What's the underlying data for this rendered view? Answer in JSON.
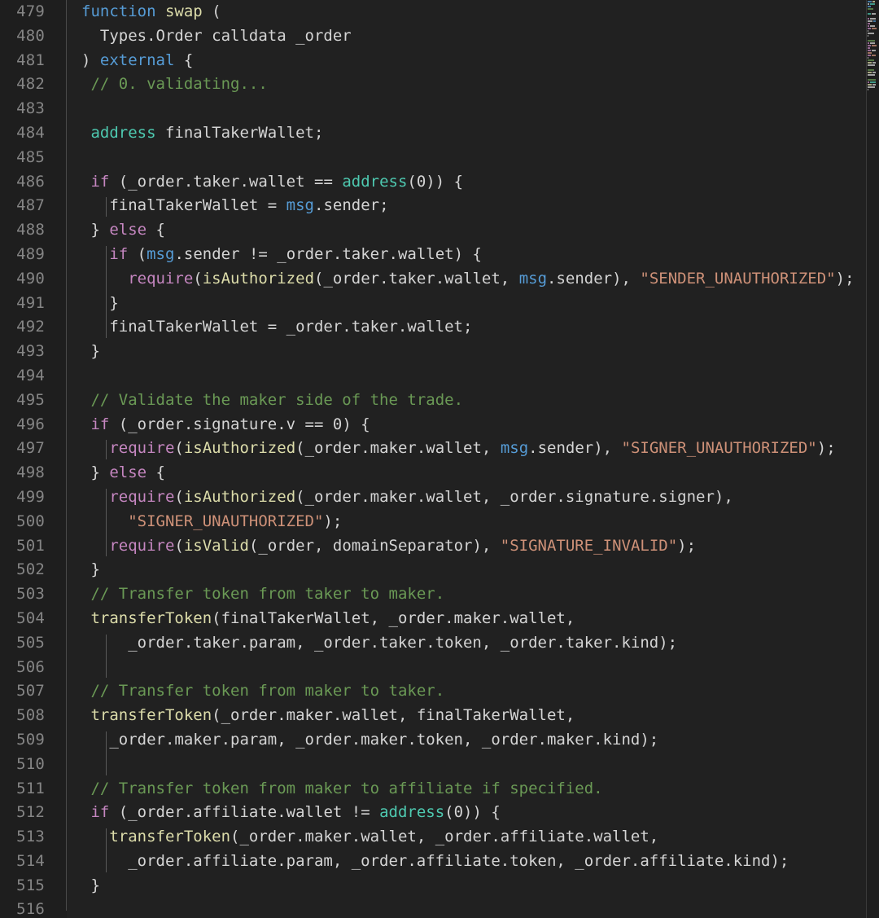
{
  "editor": {
    "language": "solidity",
    "first_line": 479,
    "last_line": 516,
    "colors": {
      "background": "#212121",
      "gutter_background": "#1e1e1e",
      "line_number": "#858585",
      "foreground": "#d4d4d4",
      "keyword": "#569cd6",
      "control": "#c586c0",
      "function": "#dcdcaa",
      "type": "#4ec9b0",
      "string": "#ce9178",
      "comment": "#6a9955",
      "indent_guide": "#5a5a5a",
      "gutter_separator": "#4a4a4a"
    }
  },
  "lines": [
    {
      "num": "479",
      "indent": 0,
      "tokens": [
        {
          "t": "function",
          "c": "t-kw"
        },
        {
          "t": " ",
          "c": "t-plain"
        },
        {
          "t": "swap",
          "c": "t-fn"
        },
        {
          "t": " (",
          "c": "t-plain"
        }
      ]
    },
    {
      "num": "480",
      "indent": 0,
      "tokens": [
        {
          "t": "  Types.Order calldata _order",
          "c": "t-plain"
        }
      ]
    },
    {
      "num": "481",
      "indent": 0,
      "tokens": [
        {
          "t": ") ",
          "c": "t-plain"
        },
        {
          "t": "external",
          "c": "t-kw"
        },
        {
          "t": " {",
          "c": "t-plain"
        }
      ]
    },
    {
      "num": "482",
      "indent": 0,
      "tokens": [
        {
          "t": " ",
          "c": "t-plain"
        },
        {
          "t": "// 0. validating...",
          "c": "t-cmt"
        }
      ]
    },
    {
      "num": "483",
      "indent": 0,
      "tokens": []
    },
    {
      "num": "484",
      "indent": 0,
      "tokens": [
        {
          "t": " ",
          "c": "t-plain"
        },
        {
          "t": "address",
          "c": "t-type"
        },
        {
          "t": " finalTakerWallet;",
          "c": "t-plain"
        }
      ]
    },
    {
      "num": "485",
      "indent": 0,
      "tokens": []
    },
    {
      "num": "486",
      "indent": 0,
      "tokens": [
        {
          "t": " ",
          "c": "t-plain"
        },
        {
          "t": "if",
          "c": "t-ctrl"
        },
        {
          "t": " (_order.taker.wallet == ",
          "c": "t-plain"
        },
        {
          "t": "address",
          "c": "t-type"
        },
        {
          "t": "(0)) {",
          "c": "t-plain"
        }
      ]
    },
    {
      "num": "487",
      "indent": 1,
      "tokens": [
        {
          "t": "   finalTakerWallet = ",
          "c": "t-plain"
        },
        {
          "t": "msg",
          "c": "t-kw"
        },
        {
          "t": ".sender;",
          "c": "t-plain"
        }
      ]
    },
    {
      "num": "488",
      "indent": 0,
      "tokens": [
        {
          "t": " } ",
          "c": "t-plain"
        },
        {
          "t": "else",
          "c": "t-ctrl"
        },
        {
          "t": " {",
          "c": "t-plain"
        }
      ]
    },
    {
      "num": "489",
      "indent": 1,
      "tokens": [
        {
          "t": "   ",
          "c": "t-plain"
        },
        {
          "t": "if",
          "c": "t-ctrl"
        },
        {
          "t": " (",
          "c": "t-plain"
        },
        {
          "t": "msg",
          "c": "t-kw"
        },
        {
          "t": ".sender != _order.taker.wallet) {",
          "c": "t-plain"
        }
      ]
    },
    {
      "num": "490",
      "indent": 1,
      "tokens": [
        {
          "t": "     ",
          "c": "t-plain"
        },
        {
          "t": "require",
          "c": "t-ctrl"
        },
        {
          "t": "(",
          "c": "t-plain"
        },
        {
          "t": "isAuthorized",
          "c": "t-fn"
        },
        {
          "t": "(_order.taker.wallet, ",
          "c": "t-plain"
        },
        {
          "t": "msg",
          "c": "t-kw"
        },
        {
          "t": ".sender), ",
          "c": "t-plain"
        },
        {
          "t": "\"SENDER_UNAUTHORIZED\"",
          "c": "t-str"
        },
        {
          "t": ");",
          "c": "t-plain"
        }
      ]
    },
    {
      "num": "491",
      "indent": 1,
      "tokens": [
        {
          "t": "   }",
          "c": "t-plain"
        }
      ]
    },
    {
      "num": "492",
      "indent": 1,
      "tokens": [
        {
          "t": "   finalTakerWallet = _order.taker.wallet;",
          "c": "t-plain"
        }
      ]
    },
    {
      "num": "493",
      "indent": 0,
      "tokens": [
        {
          "t": " }",
          "c": "t-plain"
        }
      ]
    },
    {
      "num": "494",
      "indent": 0,
      "tokens": []
    },
    {
      "num": "495",
      "indent": 0,
      "tokens": [
        {
          "t": " ",
          "c": "t-plain"
        },
        {
          "t": "// Validate the maker side of the trade.",
          "c": "t-cmt"
        }
      ]
    },
    {
      "num": "496",
      "indent": 0,
      "tokens": [
        {
          "t": " ",
          "c": "t-plain"
        },
        {
          "t": "if",
          "c": "t-ctrl"
        },
        {
          "t": " (_order.signature.v == 0) {",
          "c": "t-plain"
        }
      ]
    },
    {
      "num": "497",
      "indent": 1,
      "tokens": [
        {
          "t": "   ",
          "c": "t-plain"
        },
        {
          "t": "require",
          "c": "t-ctrl"
        },
        {
          "t": "(",
          "c": "t-plain"
        },
        {
          "t": "isAuthorized",
          "c": "t-fn"
        },
        {
          "t": "(_order.maker.wallet, ",
          "c": "t-plain"
        },
        {
          "t": "msg",
          "c": "t-kw"
        },
        {
          "t": ".sender), ",
          "c": "t-plain"
        },
        {
          "t": "\"SIGNER_UNAUTHORIZED\"",
          "c": "t-str"
        },
        {
          "t": ");",
          "c": "t-plain"
        }
      ]
    },
    {
      "num": "498",
      "indent": 0,
      "tokens": [
        {
          "t": " } ",
          "c": "t-plain"
        },
        {
          "t": "else",
          "c": "t-ctrl"
        },
        {
          "t": " {",
          "c": "t-plain"
        }
      ]
    },
    {
      "num": "499",
      "indent": 1,
      "tokens": [
        {
          "t": "   ",
          "c": "t-plain"
        },
        {
          "t": "require",
          "c": "t-ctrl"
        },
        {
          "t": "(",
          "c": "t-plain"
        },
        {
          "t": "isAuthorized",
          "c": "t-fn"
        },
        {
          "t": "(_order.maker.wallet, _order.signature.signer),",
          "c": "t-plain"
        }
      ]
    },
    {
      "num": "500",
      "indent": 1,
      "tokens": [
        {
          "t": "     ",
          "c": "t-plain"
        },
        {
          "t": "\"SIGNER_UNAUTHORIZED\"",
          "c": "t-str"
        },
        {
          "t": ");",
          "c": "t-plain"
        }
      ]
    },
    {
      "num": "501",
      "indent": 1,
      "tokens": [
        {
          "t": "   ",
          "c": "t-plain"
        },
        {
          "t": "require",
          "c": "t-ctrl"
        },
        {
          "t": "(",
          "c": "t-plain"
        },
        {
          "t": "isValid",
          "c": "t-fn"
        },
        {
          "t": "(_order, domainSeparator), ",
          "c": "t-plain"
        },
        {
          "t": "\"SIGNATURE_INVALID\"",
          "c": "t-str"
        },
        {
          "t": ");",
          "c": "t-plain"
        }
      ]
    },
    {
      "num": "502",
      "indent": 0,
      "tokens": [
        {
          "t": " }",
          "c": "t-plain"
        }
      ]
    },
    {
      "num": "503",
      "indent": 0,
      "tokens": [
        {
          "t": " ",
          "c": "t-plain"
        },
        {
          "t": "// Transfer token from taker to maker.",
          "c": "t-cmt"
        }
      ]
    },
    {
      "num": "504",
      "indent": 0,
      "tokens": [
        {
          "t": " ",
          "c": "t-plain"
        },
        {
          "t": "transferToken",
          "c": "t-fn"
        },
        {
          "t": "(finalTakerWallet, _order.maker.wallet,",
          "c": "t-plain"
        }
      ]
    },
    {
      "num": "505",
      "indent": 1,
      "tokens": [
        {
          "t": "     _order.taker.param, _order.taker.token, _order.taker.kind);",
          "c": "t-plain"
        }
      ]
    },
    {
      "num": "506",
      "indent": 1,
      "tokens": []
    },
    {
      "num": "507",
      "indent": 0,
      "tokens": [
        {
          "t": " ",
          "c": "t-plain"
        },
        {
          "t": "// Transfer token from maker to taker.",
          "c": "t-cmt"
        }
      ]
    },
    {
      "num": "508",
      "indent": 0,
      "tokens": [
        {
          "t": " ",
          "c": "t-plain"
        },
        {
          "t": "transferToken",
          "c": "t-fn"
        },
        {
          "t": "(_order.maker.wallet, finalTakerWallet,",
          "c": "t-plain"
        }
      ]
    },
    {
      "num": "509",
      "indent": 1,
      "tokens": [
        {
          "t": "   _order.maker.param, _order.maker.token, _order.maker.kind);",
          "c": "t-plain"
        }
      ]
    },
    {
      "num": "510",
      "indent": 1,
      "tokens": []
    },
    {
      "num": "511",
      "indent": 0,
      "tokens": [
        {
          "t": " ",
          "c": "t-plain"
        },
        {
          "t": "// Transfer token from maker to affiliate if specified.",
          "c": "t-cmt"
        }
      ]
    },
    {
      "num": "512",
      "indent": 0,
      "tokens": [
        {
          "t": " ",
          "c": "t-plain"
        },
        {
          "t": "if",
          "c": "t-ctrl"
        },
        {
          "t": " (_order.affiliate.wallet != ",
          "c": "t-plain"
        },
        {
          "t": "address",
          "c": "t-type"
        },
        {
          "t": "(0)) {",
          "c": "t-plain"
        }
      ]
    },
    {
      "num": "513",
      "indent": 1,
      "tokens": [
        {
          "t": "   ",
          "c": "t-plain"
        },
        {
          "t": "transferToken",
          "c": "t-fn"
        },
        {
          "t": "(_order.maker.wallet, _order.affiliate.wallet,",
          "c": "t-plain"
        }
      ]
    },
    {
      "num": "514",
      "indent": 1,
      "tokens": [
        {
          "t": "     _order.affiliate.param, _order.affiliate.token, _order.affiliate.kind);",
          "c": "t-plain"
        }
      ]
    },
    {
      "num": "515",
      "indent": 0,
      "tokens": [
        {
          "t": " }",
          "c": "t-plain"
        }
      ]
    },
    {
      "num": "516",
      "indent": 0,
      "tokens": []
    }
  ],
  "minimap": {
    "rows": [
      {
        "segs": [
          {
            "w": 5,
            "color": "#569cd6"
          },
          {
            "w": 3,
            "color": "#dcdcaa"
          }
        ]
      },
      {
        "segs": [
          {
            "w": 2,
            "color": "#d4d4d4"
          },
          {
            "w": 6,
            "color": "#4ec9b0"
          }
        ]
      },
      {
        "segs": [
          {
            "w": 4,
            "color": "#569cd6"
          }
        ]
      },
      {
        "segs": [
          {
            "w": 7,
            "color": "#6a9955"
          }
        ]
      },
      {
        "segs": []
      },
      {
        "segs": [
          {
            "w": 4,
            "color": "#4ec9b0"
          },
          {
            "w": 5,
            "color": "#d4d4d4"
          }
        ]
      },
      {
        "segs": []
      },
      {
        "segs": [
          {
            "w": 2,
            "color": "#c586c0"
          },
          {
            "w": 7,
            "color": "#d4d4d4"
          }
        ]
      },
      {
        "segs": [
          {
            "w": 6,
            "color": "#d4d4d4"
          },
          {
            "w": 3,
            "color": "#569cd6"
          }
        ]
      },
      {
        "segs": [
          {
            "w": 3,
            "color": "#c586c0"
          }
        ]
      },
      {
        "segs": [
          {
            "w": 2,
            "color": "#c586c0"
          },
          {
            "w": 6,
            "color": "#d4d4d4"
          }
        ]
      },
      {
        "segs": [
          {
            "w": 4,
            "color": "#c586c0"
          },
          {
            "w": 6,
            "color": "#ce9178"
          }
        ]
      },
      {
        "segs": [
          {
            "w": 1,
            "color": "#d4d4d4"
          }
        ]
      },
      {
        "segs": [
          {
            "w": 8,
            "color": "#d4d4d4"
          }
        ]
      },
      {
        "segs": [
          {
            "w": 1,
            "color": "#d4d4d4"
          }
        ]
      },
      {
        "segs": []
      },
      {
        "segs": [
          {
            "w": 9,
            "color": "#6a9955"
          }
        ]
      },
      {
        "segs": [
          {
            "w": 2,
            "color": "#c586c0"
          },
          {
            "w": 6,
            "color": "#d4d4d4"
          }
        ]
      },
      {
        "segs": [
          {
            "w": 4,
            "color": "#c586c0"
          },
          {
            "w": 6,
            "color": "#ce9178"
          }
        ]
      },
      {
        "segs": [
          {
            "w": 3,
            "color": "#c586c0"
          }
        ]
      },
      {
        "segs": [
          {
            "w": 4,
            "color": "#c586c0"
          },
          {
            "w": 5,
            "color": "#d4d4d4"
          }
        ]
      },
      {
        "segs": [
          {
            "w": 5,
            "color": "#ce9178"
          }
        ]
      },
      {
        "segs": [
          {
            "w": 4,
            "color": "#c586c0"
          },
          {
            "w": 5,
            "color": "#ce9178"
          }
        ]
      },
      {
        "segs": [
          {
            "w": 1,
            "color": "#d4d4d4"
          }
        ]
      },
      {
        "segs": [
          {
            "w": 8,
            "color": "#6a9955"
          }
        ]
      },
      {
        "segs": [
          {
            "w": 5,
            "color": "#dcdcaa"
          },
          {
            "w": 4,
            "color": "#d4d4d4"
          }
        ]
      },
      {
        "segs": [
          {
            "w": 9,
            "color": "#d4d4d4"
          }
        ]
      },
      {
        "segs": []
      },
      {
        "segs": [
          {
            "w": 8,
            "color": "#6a9955"
          }
        ]
      },
      {
        "segs": [
          {
            "w": 5,
            "color": "#dcdcaa"
          },
          {
            "w": 4,
            "color": "#d4d4d4"
          }
        ]
      },
      {
        "segs": [
          {
            "w": 9,
            "color": "#d4d4d4"
          }
        ]
      },
      {
        "segs": []
      },
      {
        "segs": [
          {
            "w": 10,
            "color": "#6a9955"
          }
        ]
      },
      {
        "segs": [
          {
            "w": 2,
            "color": "#c586c0"
          },
          {
            "w": 7,
            "color": "#4ec9b0"
          }
        ]
      },
      {
        "segs": [
          {
            "w": 5,
            "color": "#dcdcaa"
          },
          {
            "w": 4,
            "color": "#d4d4d4"
          }
        ]
      },
      {
        "segs": [
          {
            "w": 9,
            "color": "#d4d4d4"
          }
        ]
      },
      {
        "segs": [
          {
            "w": 1,
            "color": "#d4d4d4"
          }
        ]
      },
      {
        "segs": []
      }
    ]
  }
}
